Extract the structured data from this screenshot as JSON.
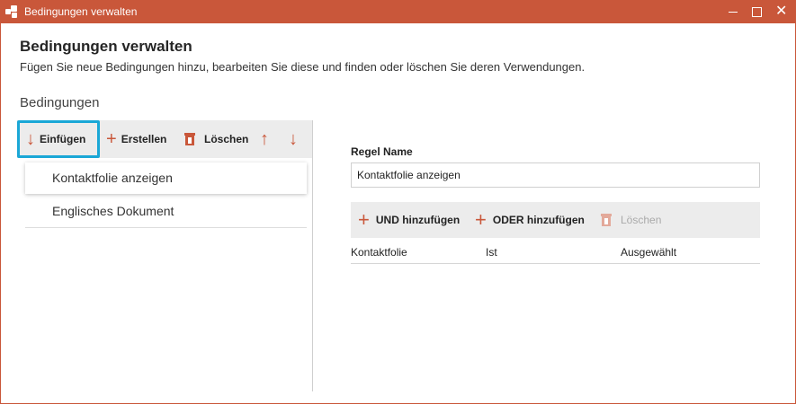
{
  "window": {
    "title": "Bedingungen verwalten"
  },
  "header": {
    "title": "Bedingungen verwalten",
    "subtitle": "Fügen Sie neue Bedingungen hinzu, bearbeiten Sie diese und finden oder löschen Sie deren Verwendungen."
  },
  "conditions": {
    "section_label": "Bedingungen",
    "toolbar": {
      "insert_label": "Einfügen",
      "create_label": "Erstellen",
      "delete_label": "Löschen"
    },
    "items": [
      {
        "label": "Kontaktfolie anzeigen",
        "selected": true
      },
      {
        "label": "Englisches Dokument",
        "selected": false
      }
    ]
  },
  "rule": {
    "name_label": "Regel Name",
    "name_value": "Kontaktfolie anzeigen",
    "toolbar": {
      "and_label": "UND hinzufügen",
      "or_label": "ODER hinzufügen",
      "delete_label": "Löschen"
    },
    "rows": [
      {
        "field": "Kontaktfolie",
        "operator": "Ist",
        "value": "Ausgewählt"
      }
    ]
  },
  "colors": {
    "accent": "#c9573a",
    "focus": "#1aa7d6",
    "toolbar_bg": "#ececec"
  },
  "icons": [
    "app-icon",
    "arrow-down-icon",
    "plus-icon",
    "trash-icon",
    "arrow-up-icon",
    "minimize-icon",
    "maximize-icon",
    "close-icon"
  ]
}
